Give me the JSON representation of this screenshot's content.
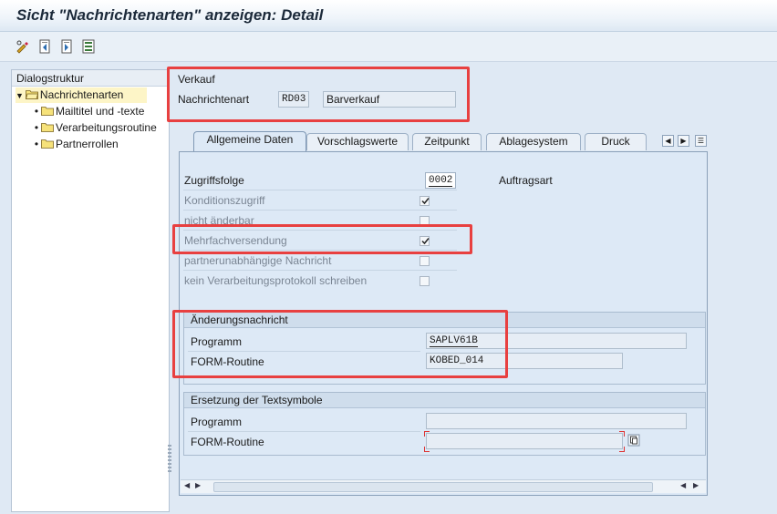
{
  "window": {
    "title": "Sicht \"Nachrichtenarten\" anzeigen: Detail"
  },
  "toolbar": {
    "buttons": [
      {
        "icon": "display-change-icon"
      },
      {
        "icon": "previous-entry-icon"
      },
      {
        "icon": "next-entry-icon"
      },
      {
        "icon": "select-all-icon"
      }
    ]
  },
  "dialog_structure": {
    "title": "Dialogstruktur",
    "items": [
      {
        "label": "Nachrichtenarten",
        "level": 0,
        "selected": true
      },
      {
        "label": "Mailtitel und -texte",
        "level": 1
      },
      {
        "label": "Verarbeitungsroutine",
        "level": 1
      },
      {
        "label": "Partnerrollen",
        "level": 1
      }
    ]
  },
  "header": {
    "section": "Verkauf",
    "message_type_label": "Nachrichtenart",
    "message_type_value": "RD03",
    "message_type_description": "Barverkauf"
  },
  "tabs": [
    "Allgemeine Daten",
    "Vorschlagswerte",
    "Zeitpunkt",
    "Ablagesystem",
    "Druck"
  ],
  "general": {
    "access_sequence_label": "Zugriffsfolge",
    "access_sequence_value": "0002",
    "access_sequence_text": "Auftragsart",
    "checkboxes": [
      {
        "label": "Konditionszugriff",
        "checked": true
      },
      {
        "label": "nicht änderbar",
        "checked": false
      },
      {
        "label": "Mehrfachversendung",
        "checked": true
      },
      {
        "label": "partnerunabhängige Nachricht",
        "checked": false
      },
      {
        "label": "kein Verarbeitungsprotokoll schreiben",
        "checked": false
      }
    ]
  },
  "change_message": {
    "title": "Änderungsnachricht",
    "program_label": "Programm",
    "program_value": "SAPLV61B",
    "form_label": "FORM-Routine",
    "form_value": "KOBED_014"
  },
  "text_symbols": {
    "title": "Ersetzung der Textsymbole",
    "program_label": "Programm",
    "program_value": "",
    "form_label": "FORM-Routine",
    "form_value": ""
  },
  "colors": {
    "highlight": "#e84040",
    "selected_row": "#fdf5c7",
    "panel": "#dde9f6"
  }
}
